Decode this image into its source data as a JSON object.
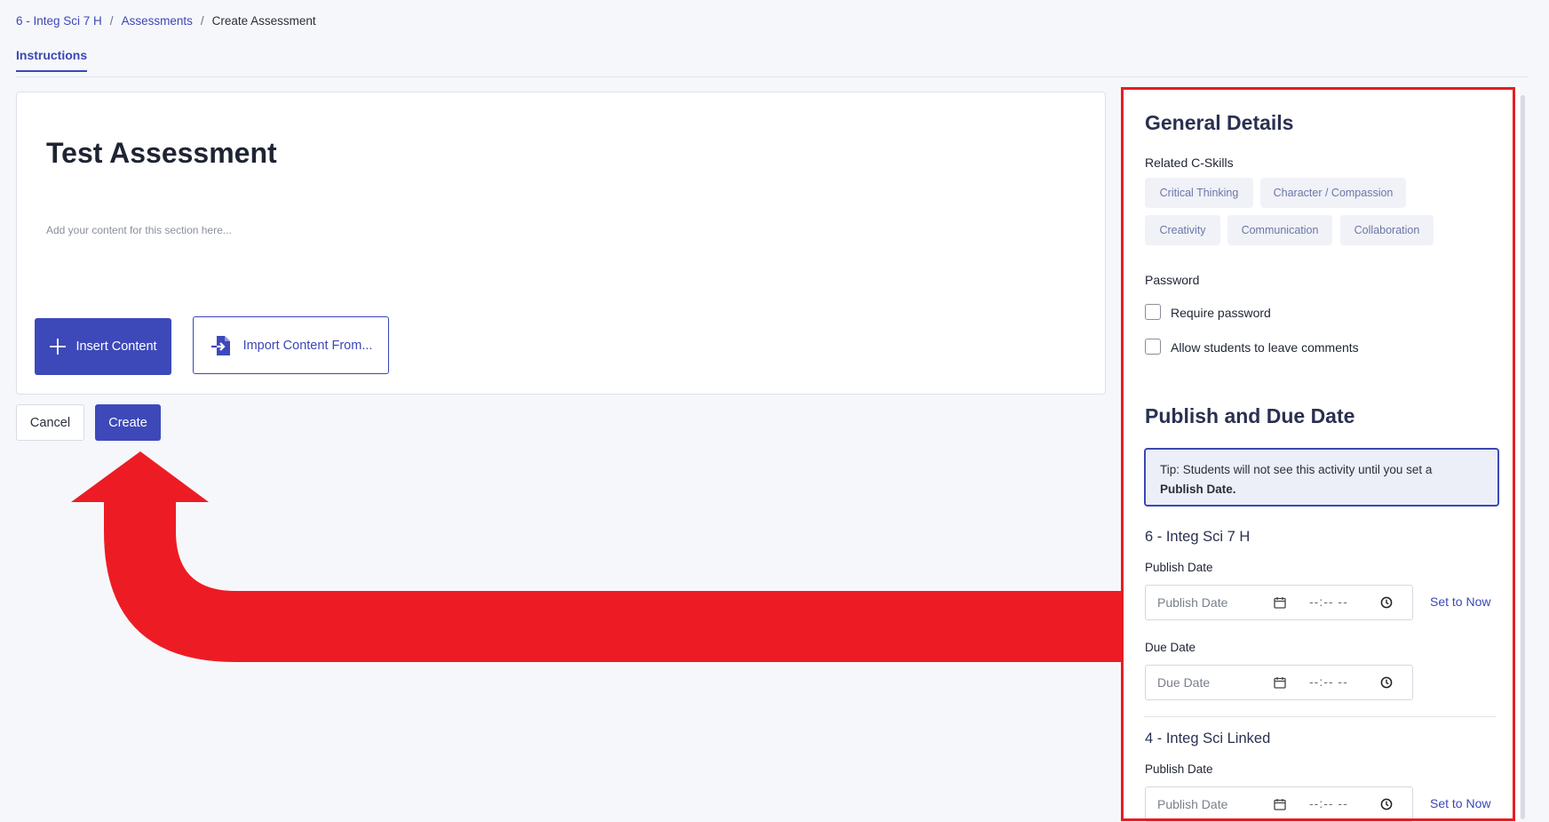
{
  "breadcrumb": {
    "course": "6 - Integ Sci 7 H",
    "assessments": "Assessments",
    "current": "Create Assessment",
    "separator": "/"
  },
  "tabs": {
    "instructions": "Instructions"
  },
  "editor": {
    "title": "Test Assessment",
    "placeholder": "Add your content for this section here...",
    "insert_label": "Insert Content",
    "import_label": "Import Content From..."
  },
  "actions": {
    "cancel": "Cancel",
    "create": "Create"
  },
  "panel": {
    "general_title": "General Details",
    "skills_label": "Related C-Skills",
    "skills": [
      "Critical Thinking",
      "Character / Compassion",
      "Creativity",
      "Communication",
      "Collaboration"
    ],
    "password_label": "Password",
    "require_password": "Require password",
    "allow_comments": "Allow students to leave comments",
    "publish_title": "Publish and Due Date",
    "tip_text": "Tip: Students will not see this activity until you set a",
    "tip_bold": "Publish Date.",
    "sections": [
      {
        "name": "6 - Integ Sci 7 H",
        "publish_label": "Publish Date",
        "publish_placeholder": "Publish Date",
        "time_placeholder": "--:-- --",
        "set_now": "Set to Now",
        "due_label": "Due Date",
        "due_placeholder": "Due Date"
      },
      {
        "name": "4 - Integ Sci Linked",
        "publish_label": "Publish Date",
        "publish_placeholder": "Publish Date",
        "time_placeholder": "--:-- --",
        "set_now": "Set to Now"
      }
    ]
  },
  "colors": {
    "accent": "#3d49b9",
    "annotation": "#e31e24",
    "background": "#f6f7fb"
  },
  "icons": {
    "plus": "plus-icon",
    "import": "import-file-icon",
    "calendar": "calendar-icon",
    "clock": "clock-icon",
    "arrow": "curved-arrow-annotation"
  }
}
